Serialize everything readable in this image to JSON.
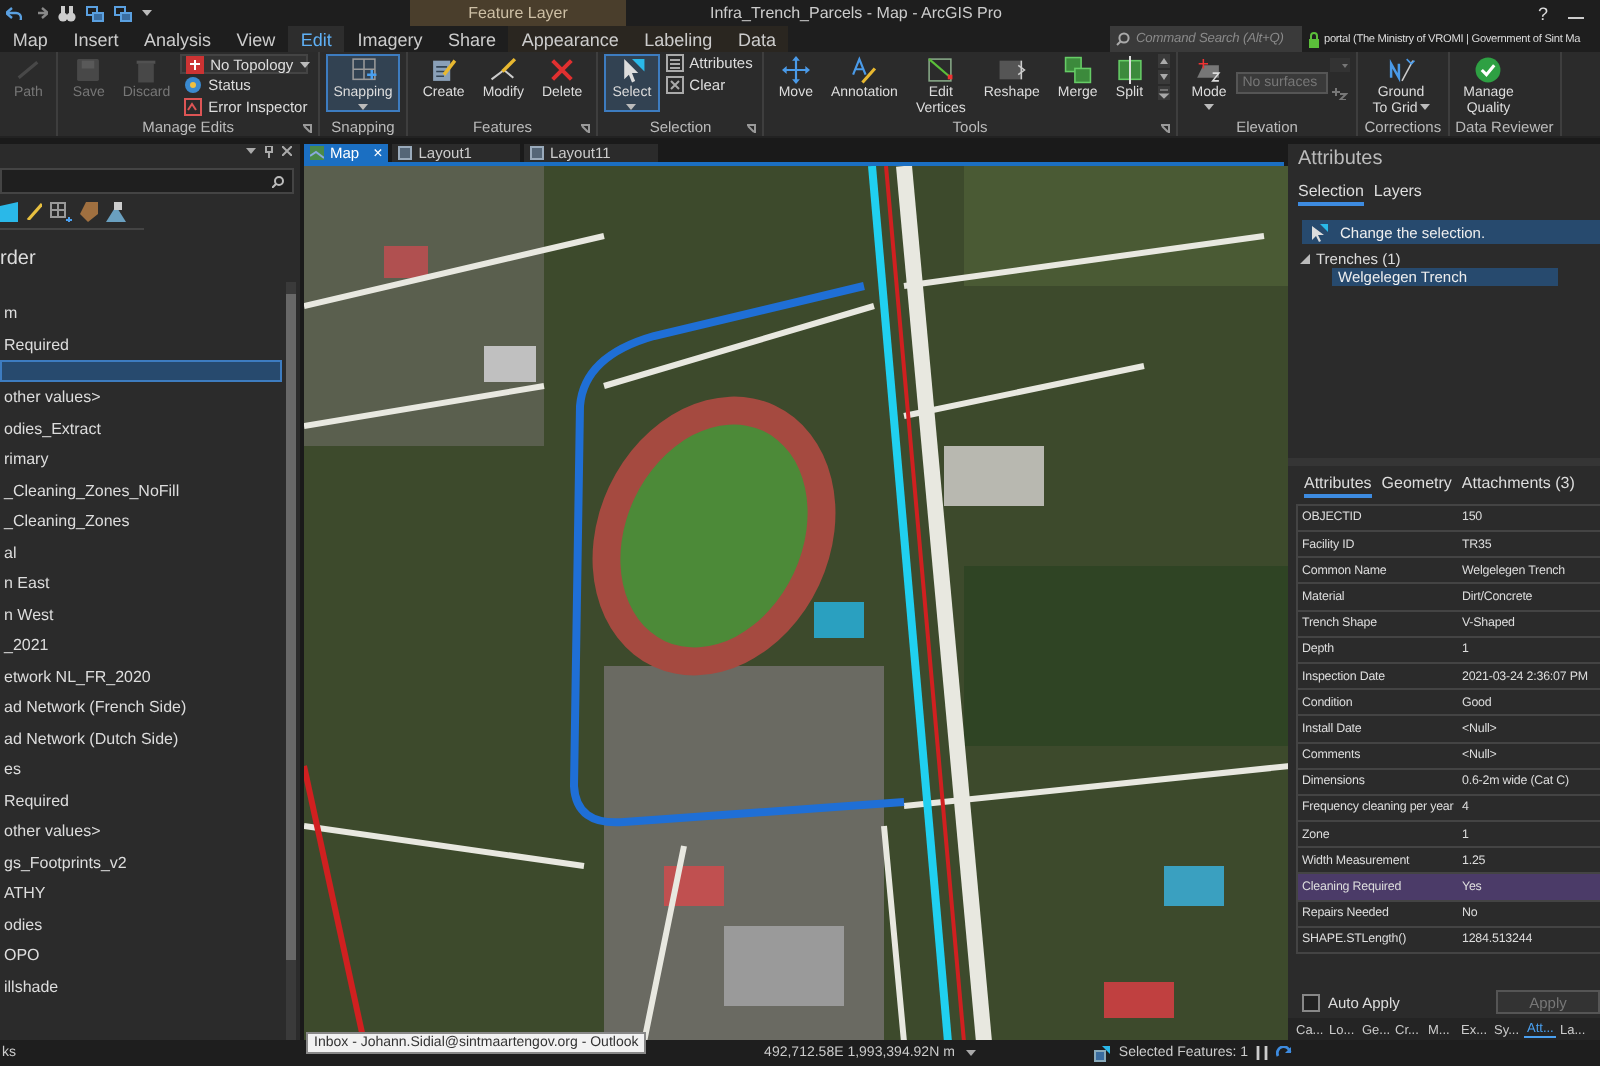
{
  "title_bar": {
    "context_group": "Feature Layer",
    "title": "Infra_Trench_Parcels - Map - ArcGIS Pro",
    "help": "?"
  },
  "ribbon_tabs": [
    {
      "label": "Map",
      "selected": false,
      "contextual": false
    },
    {
      "label": "Insert",
      "selected": false,
      "contextual": false
    },
    {
      "label": "Analysis",
      "selected": false,
      "contextual": false
    },
    {
      "label": "View",
      "selected": false,
      "contextual": false
    },
    {
      "label": "Edit",
      "selected": true,
      "contextual": false
    },
    {
      "label": "Imagery",
      "selected": false,
      "contextual": false
    },
    {
      "label": "Share",
      "selected": false,
      "contextual": false
    },
    {
      "label": "Appearance",
      "selected": false,
      "contextual": true
    },
    {
      "label": "Labeling",
      "selected": false,
      "contextual": true
    },
    {
      "label": "Data",
      "selected": false,
      "contextual": true
    }
  ],
  "command_search": {
    "placeholder": "Command Search (Alt+Q)"
  },
  "portal": {
    "label": "portal (The Ministry of VROMI | Government of Sint Ma"
  },
  "ribbon_groups": [
    {
      "controls": [
        {
          "kind": "large",
          "label": "Path",
          "disabled": true,
          "on": false,
          "menu": false
        }
      ]
    },
    {
      "label": "Manage Edits",
      "launcher": true,
      "controls": [
        {
          "kind": "large",
          "label": "Save",
          "disabled": true,
          "on": false,
          "menu": false
        },
        {
          "kind": "large",
          "label": "Discard",
          "disabled": true,
          "on": false,
          "menu": false
        },
        {
          "kind": "dropdown",
          "label": "No Topology",
          "disabled": false,
          "menu": true
        },
        {
          "kind": "small",
          "label": "Status",
          "disabled": false
        },
        {
          "kind": "small",
          "label": "Error Inspector",
          "disabled": false
        }
      ]
    },
    {
      "label": "Snapping",
      "controls": [
        {
          "kind": "large",
          "label": "Snapping",
          "disabled": false,
          "on": true,
          "menu": true
        }
      ]
    },
    {
      "label": "Features",
      "launcher": true,
      "controls": [
        {
          "kind": "large",
          "label": "Create",
          "disabled": false,
          "on": false,
          "menu": false
        },
        {
          "kind": "large",
          "label": "Modify",
          "disabled": false,
          "on": false,
          "menu": false
        },
        {
          "kind": "large",
          "label": "Delete",
          "disabled": false,
          "on": false,
          "menu": false
        }
      ]
    },
    {
      "label": "Selection",
      "launcher": true,
      "controls": [
        {
          "kind": "large",
          "label": "Select",
          "disabled": false,
          "on": true,
          "menu": true
        },
        {
          "kind": "small",
          "label": "Attributes",
          "disabled": false
        },
        {
          "kind": "small",
          "label": "Clear",
          "disabled": false
        }
      ]
    },
    {
      "label": "Tools",
      "launcher": true,
      "gallery": true,
      "controls": [
        {
          "kind": "large",
          "label": "Move",
          "disabled": false,
          "on": false,
          "menu": false
        },
        {
          "kind": "large",
          "label": "Annotation",
          "disabled": false,
          "on": false,
          "menu": false
        },
        {
          "kind": "large",
          "label": "Edit Vertices",
          "disabled": false,
          "on": false,
          "menu": false
        },
        {
          "kind": "large",
          "label": "Reshape",
          "disabled": false,
          "on": false,
          "menu": false
        },
        {
          "kind": "large",
          "label": "Merge",
          "disabled": false,
          "on": false,
          "menu": false
        },
        {
          "kind": "large",
          "label": "Split",
          "disabled": false,
          "on": false,
          "menu": false
        }
      ]
    },
    {
      "label": "Elevation",
      "controls": [
        {
          "kind": "large",
          "label": "Mode",
          "disabled": false,
          "on": false,
          "menu": true
        },
        {
          "kind": "field",
          "placeholder": "No surfaces",
          "disabled": true
        }
      ]
    },
    {
      "label": "Corrections",
      "controls": [
        {
          "kind": "large",
          "label": "Ground To Grid",
          "disabled": false,
          "on": false,
          "menu": true
        }
      ]
    },
    {
      "label": "Data Reviewer",
      "controls": [
        {
          "kind": "large",
          "label": "Manage Quality",
          "disabled": false,
          "on": false,
          "menu": false
        }
      ]
    }
  ],
  "contents": {
    "heading": "rder",
    "items": [
      {
        "label": "m",
        "selected": false
      },
      {
        "label": "Required",
        "selected": false
      },
      {
        "selected": true
      },
      {
        "label": "other values>",
        "selected": false
      },
      {
        "label": "odies_Extract",
        "selected": false
      },
      {
        "label": "rimary",
        "selected": false
      },
      {
        "label": "_Cleaning_Zones_NoFill",
        "selected": false
      },
      {
        "label": "_Cleaning_Zones",
        "selected": false
      },
      {
        "label": "al",
        "selected": false
      },
      {
        "label": "n East",
        "selected": false
      },
      {
        "label": "n West",
        "selected": false
      },
      {
        "label": "_2021",
        "selected": false
      },
      {
        "label": "etwork NL_FR_2020",
        "selected": false
      },
      {
        "label": "ad Network (French Side)",
        "selected": false
      },
      {
        "label": "ad Network (Dutch Side)",
        "selected": false
      },
      {
        "label": "es",
        "selected": false
      },
      {
        "label": "Required",
        "selected": false
      },
      {
        "label": "other values>",
        "selected": false
      },
      {
        "label": "gs_Footprints_v2",
        "selected": false
      },
      {
        "label": "ATHY",
        "selected": false
      },
      {
        "label": "odies",
        "selected": false
      },
      {
        "label": "OPO",
        "selected": false
      },
      {
        "label": "illshade",
        "selected": false
      }
    ]
  },
  "map_tabs": [
    {
      "label": "Map",
      "selected": true,
      "close": "×"
    },
    {
      "label": "Layout1",
      "selected": false
    },
    {
      "label": "Layout11",
      "selected": false
    }
  ],
  "attributes_pane": {
    "title": "Attributes",
    "tabs": [
      {
        "label": "Selection",
        "selected": true
      },
      {
        "label": "Layers",
        "selected": false
      }
    ],
    "banner": "Change the selection.",
    "tree": [
      {
        "label": "Trenches (1)",
        "expanded": true,
        "children": [
          {
            "label": "Welgelegen Trench",
            "selected": true
          }
        ]
      }
    ],
    "detail_tabs": [
      {
        "label": "Attributes",
        "selected": true
      },
      {
        "label": "Geometry",
        "selected": false
      },
      {
        "label": "Attachments (3)",
        "selected": false
      }
    ],
    "rows": [
      {
        "field": "OBJECTID",
        "value": "150",
        "selected": false
      },
      {
        "field": "Facility ID",
        "value": "TR35",
        "selected": false
      },
      {
        "field": "Common Name",
        "value": "Welgelegen Trench",
        "selected": false
      },
      {
        "field": "Material",
        "value": "Dirt/Concrete",
        "selected": false
      },
      {
        "field": "Trench Shape",
        "value": "V-Shaped",
        "selected": false
      },
      {
        "field": "Depth",
        "value": "1",
        "selected": false
      },
      {
        "field": "Inspection Date",
        "value": "2021-03-24 2:36:07 PM",
        "selected": false
      },
      {
        "field": "Condition",
        "value": "Good",
        "selected": false
      },
      {
        "field": "Install Date",
        "value": "<Null>",
        "selected": false
      },
      {
        "field": "Comments",
        "value": "<Null>",
        "selected": false
      },
      {
        "field": "Dimensions",
        "value": "0.6-2m wide (Cat C)",
        "selected": false
      },
      {
        "field": "Frequency cleaning per year",
        "value": "4",
        "selected": false
      },
      {
        "field": "Zone",
        "value": "1",
        "selected": false
      },
      {
        "field": "Width Measurement",
        "value": "1.25",
        "selected": false
      },
      {
        "field": "Cleaning Required",
        "value": "Yes",
        "selected": true
      },
      {
        "field": "Repairs Needed",
        "value": "No",
        "selected": false
      },
      {
        "field": "SHAPE.STLength()",
        "value": "1284.513244",
        "selected": false
      }
    ],
    "auto_apply": {
      "label": "Auto Apply",
      "checked": false
    },
    "apply": {
      "label": "Apply",
      "disabled": true
    },
    "bottom_tabs": [
      {
        "label": "Ca...",
        "selected": false
      },
      {
        "label": "Lo...",
        "selected": false
      },
      {
        "label": "Ge...",
        "selected": false
      },
      {
        "label": "Cr...",
        "selected": false
      },
      {
        "label": "M...",
        "selected": false
      },
      {
        "label": "Ex...",
        "selected": false
      },
      {
        "label": "Sy...",
        "selected": false
      },
      {
        "label": "Att...",
        "selected": true
      },
      {
        "label": "La...",
        "selected": false
      }
    ]
  },
  "status_bar": {
    "left": "ks",
    "tooltip": "Inbox - Johann.Sidial@sintmaartengov.org - Outlook",
    "coordinates": "492,712.58E 1,993,394.92N m",
    "selected_features": "Selected Features: 1"
  }
}
